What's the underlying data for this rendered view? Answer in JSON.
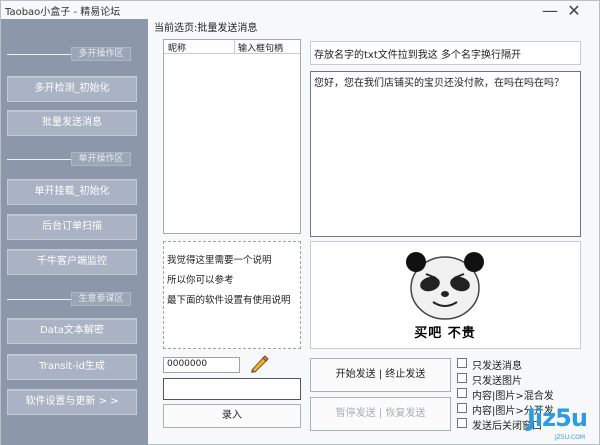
{
  "window": {
    "title": "Taobao小盒子 - 精易论坛",
    "minimize_glyph": "—",
    "close_glyph": "✕"
  },
  "sidebar": {
    "groups": [
      {
        "label": "多开操作区"
      },
      {
        "label": "单开操作区"
      },
      {
        "label": "生意参谋区"
      }
    ],
    "buttons": [
      {
        "label": "多开检测_初始化"
      },
      {
        "label": "批量发送消息"
      },
      {
        "label": "单开挂载_初始化"
      },
      {
        "label": "后台订单扫描"
      },
      {
        "label": "千牛客户端监控"
      },
      {
        "label": "Data文本解密"
      },
      {
        "label": "Transit-id生成"
      },
      {
        "label": "软件设置与更新 > >"
      }
    ]
  },
  "main": {
    "current_page": "当前选页:批量发送消息",
    "list_columns": [
      "昵称",
      "输入框句柄"
    ],
    "hint_text": "存放名字的txt文件拉到我这 多个名字换行隔开",
    "message_text": "您好，您在我们店铺买的宝贝还没付款，在吗在吗在吗？",
    "description_lines": [
      "我觉得这里需要一个说明",
      "所以你可以参考",
      "最下面的软件设置有使用说明"
    ],
    "meme_caption": "买吧 不贵",
    "qty_value": "0000000",
    "text_input_value": "",
    "record_button": "录入",
    "start_stop_button": "开始发送 | 终止发送",
    "pause_resume_button": "暂停发送 | 恢复发送",
    "options": [
      {
        "label": "只发送消息",
        "checked": false
      },
      {
        "label": "只发送图片",
        "checked": false
      },
      {
        "label": "内容|图片>混合发",
        "checked": false
      },
      {
        "label": "内容|图片>分开发",
        "checked": false
      },
      {
        "label": "发送后关闭窗口",
        "checked": false
      }
    ]
  },
  "watermark": {
    "text": "Jiz5u",
    "sub": "JZ5U.COM"
  }
}
